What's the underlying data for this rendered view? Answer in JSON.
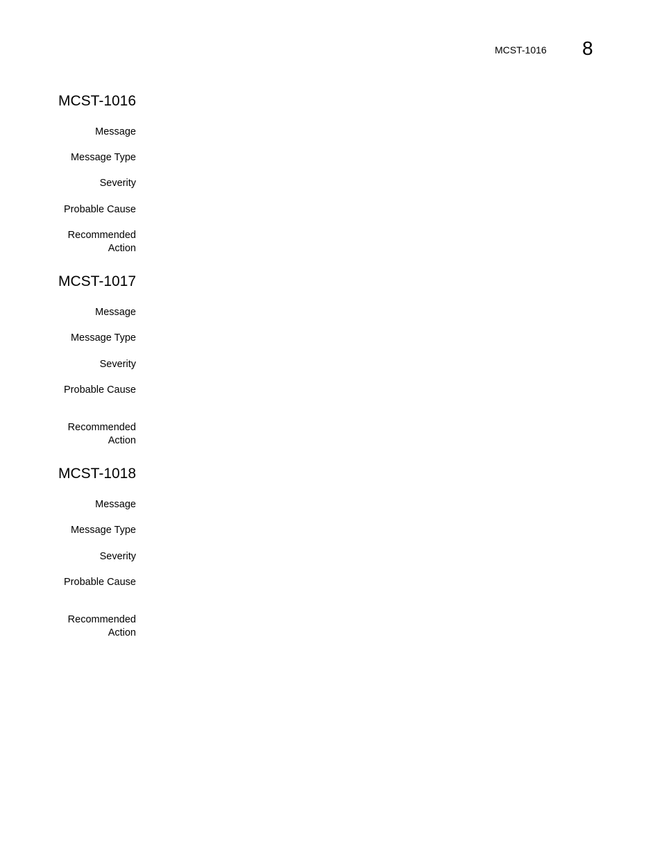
{
  "header": {
    "running_title": "MCST-1016",
    "chapter_number": "8"
  },
  "entries": [
    {
      "title": "MCST-1016",
      "labels": {
        "message": "Message",
        "message_type": "Message Type",
        "severity": "Severity",
        "probable_cause": "Probable Cause",
        "recommended_action_line1": "Recommended",
        "recommended_action_line2": "Action"
      }
    },
    {
      "title": "MCST-1017",
      "labels": {
        "message": "Message",
        "message_type": "Message Type",
        "severity": "Severity",
        "probable_cause": "Probable Cause",
        "recommended_action_line1": "Recommended",
        "recommended_action_line2": "Action"
      }
    },
    {
      "title": "MCST-1018",
      "labels": {
        "message": "Message",
        "message_type": "Message Type",
        "severity": "Severity",
        "probable_cause": "Probable Cause",
        "recommended_action_line1": "Recommended",
        "recommended_action_line2": "Action"
      }
    }
  ]
}
